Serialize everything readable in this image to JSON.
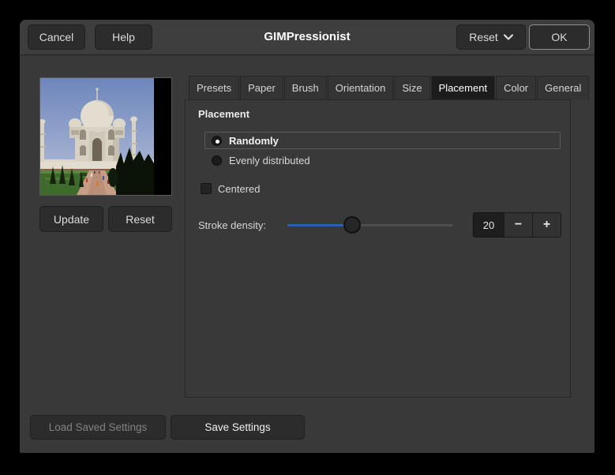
{
  "window": {
    "title": "GIMPressionist"
  },
  "header": {
    "cancel_label": "Cancel",
    "help_label": "Help",
    "reset_label": "Reset",
    "ok_label": "OK"
  },
  "preview": {
    "image": "taj-mahal-photograph",
    "update_label": "Update",
    "reset_label": "Reset"
  },
  "tabs": [
    {
      "label": "Presets",
      "selected": false
    },
    {
      "label": "Paper",
      "selected": false
    },
    {
      "label": "Brush",
      "selected": false
    },
    {
      "label": "Orientation",
      "selected": false
    },
    {
      "label": "Size",
      "selected": false
    },
    {
      "label": "Placement",
      "selected": true
    },
    {
      "label": "Color",
      "selected": false
    },
    {
      "label": "General",
      "selected": false
    }
  ],
  "placement_panel": {
    "heading": "Placement",
    "options": [
      {
        "label": "Randomly",
        "selected": true
      },
      {
        "label": "Evenly distributed",
        "selected": false
      }
    ],
    "centered": {
      "label": "Centered",
      "checked": false
    },
    "stroke_density": {
      "label": "Stroke density:",
      "value": "20",
      "slider_fill_percent": 39,
      "decrement_label": "−",
      "increment_label": "+"
    }
  },
  "footer": {
    "load_label": "Load Saved Settings",
    "load_enabled": false,
    "save_label": "Save Settings"
  },
  "colors": {
    "accent_blue": "#2b62ae",
    "dialog_bg": "#393939",
    "header_bg": "#3e3e3e",
    "button_bg": "#2c2c2c",
    "selected_tab_bg": "#1c1c1c"
  }
}
